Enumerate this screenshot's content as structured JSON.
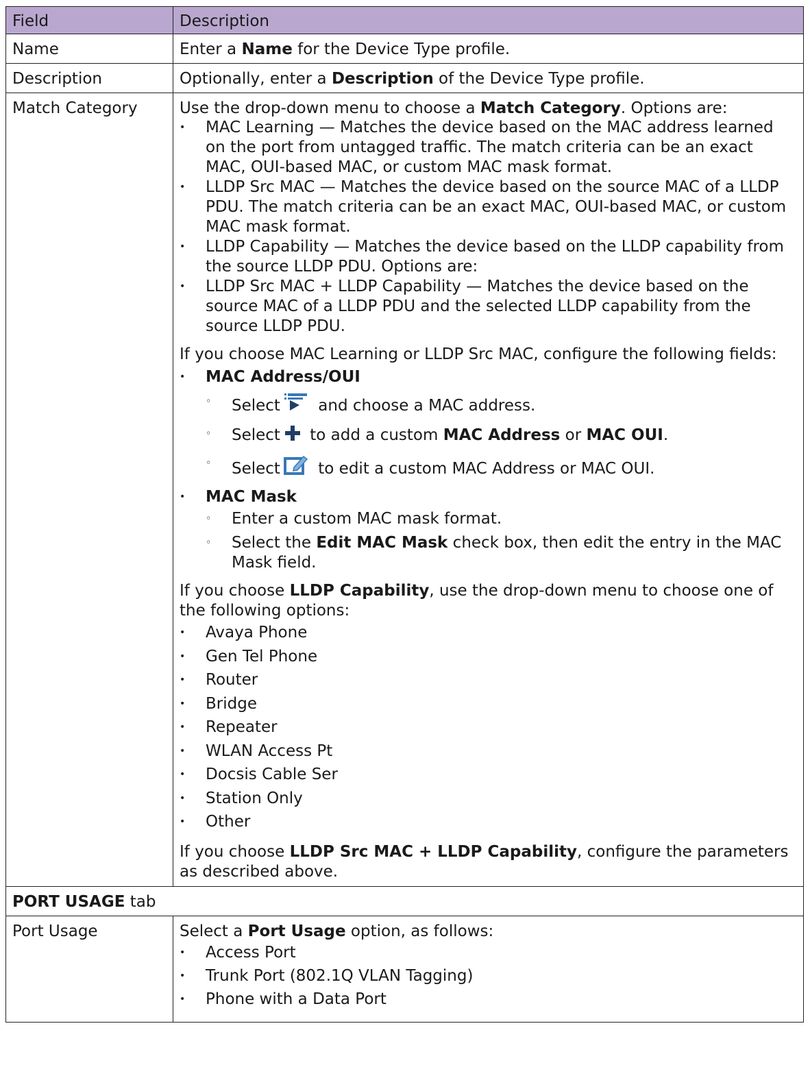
{
  "table": {
    "header": {
      "field": "Field",
      "description": "Description"
    },
    "name_row": {
      "field": "Name",
      "pre": "Enter a ",
      "bold": "Name",
      "post": " for the Device Type profile."
    },
    "description_row": {
      "field": "Description",
      "pre": "Optionally, enter a ",
      "bold": "Description",
      "post": " of the Device Type profile."
    },
    "match_row": {
      "field": "Match Category",
      "intro_pre": "Use the drop-down menu to choose a ",
      "intro_bold": "Match Category",
      "intro_post": ". Options are:",
      "options": [
        {
          "term": "MAC Learning",
          "text": " — Matches the device based on the MAC address learned on the port from untagged traffic. The match criteria can be an exact MAC, OUI-based MAC, or custom MAC mask format."
        },
        {
          "term": "LLDP Src MAC",
          "text": " — Matches the device based on the source MAC of a LLDP PDU. The match criteria can be an exact MAC, OUI-based MAC, or custom MAC mask format."
        },
        {
          "term": "LLDP Capability",
          "text": " — Matches the device based on the LLDP capability from the source LLDP PDU. Options are:"
        },
        {
          "term": "LLDP Src MAC + LLDP Capability",
          "text": " — Matches the device based on the source MAC of a LLDP PDU and the selected LLDP capability from the source LLDP PDU."
        }
      ],
      "mac_para": {
        "pre": "If you choose ",
        "b1": "MAC Learning",
        "mid": " or ",
        "b2": "LLDP Src MAC",
        "post": ", configure the following fields:"
      },
      "mac_address": {
        "title": "MAC Address/OUI",
        "items": [
          {
            "pre": "Select",
            "post": " and choose a MAC address.",
            "icon": "filter-icon"
          },
          {
            "pre": "Select",
            "mid": " to add a custom ",
            "b1": "MAC Address",
            "or": " or ",
            "b2": "MAC OUI",
            "end": ".",
            "icon": "plus-icon"
          },
          {
            "pre": "Select",
            "post": " to edit a custom MAC Address or MAC OUI.",
            "icon": "edit-icon"
          }
        ]
      },
      "mac_mask": {
        "title": "MAC Mask",
        "items": [
          {
            "text": "Enter a custom MAC mask format."
          },
          {
            "pre": "Select the ",
            "bold": "Edit MAC Mask",
            "post": " check box, then edit the entry in the MAC Mask field."
          }
        ]
      },
      "lldp_para": {
        "pre": "If you choose ",
        "bold": "LLDP Capability",
        "post": ", use the drop-down menu to choose one of the following options:"
      },
      "lldp_options": [
        "Avaya Phone",
        "Gen Tel Phone",
        "Router",
        "Bridge",
        "Repeater",
        "WLAN Access Pt",
        "Docsis Cable Ser",
        "Station Only",
        "Other"
      ],
      "combo_para": {
        "pre": "If you choose ",
        "bold": "LLDP Src MAC + LLDP Capability",
        "post": ", configure the parameters as described above."
      }
    },
    "section_row": {
      "bold": "PORT USAGE",
      "post": " tab"
    },
    "port_usage_row": {
      "field": "Port Usage",
      "pre": "Select a ",
      "bold": "Port Usage",
      "post": " option, as follows:",
      "options": [
        "Access Port",
        "Trunk Port (802.1Q VLAN Tagging)",
        "Phone with a Data Port"
      ]
    }
  },
  "colors": {
    "header_bg": "#b9a7cf",
    "icon_blue": "#3a78b8",
    "icon_dark": "#1f3f66"
  }
}
